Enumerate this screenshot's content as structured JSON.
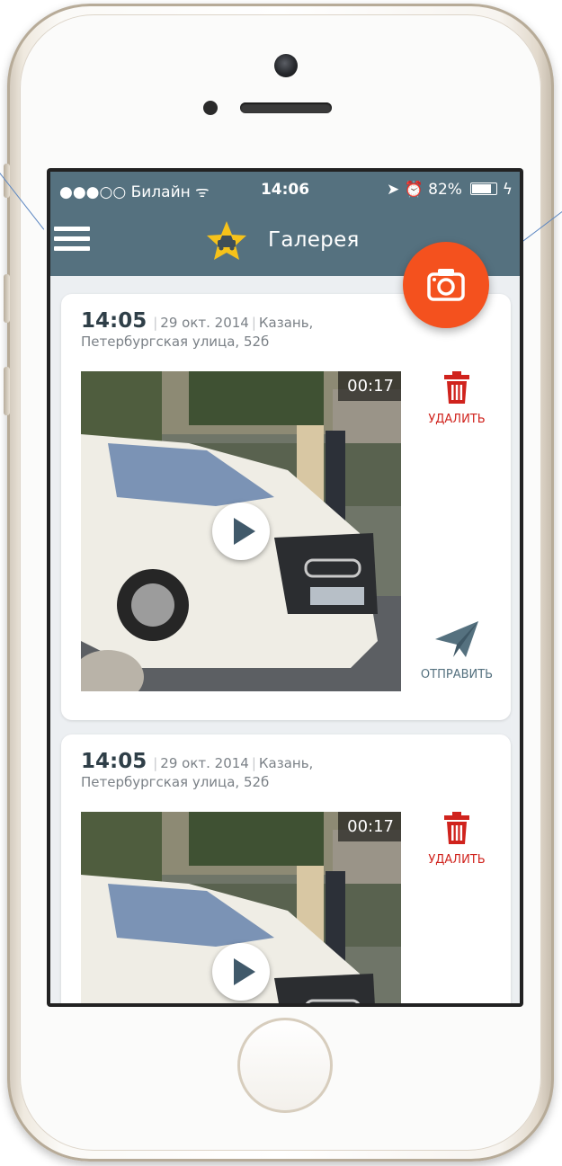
{
  "status_bar": {
    "signal_and_carrier": "●●●○○ Билайн ᯤ",
    "time": "14:06",
    "indicators": "➤ ⏰ 82%",
    "charging_glyph": "ϟ"
  },
  "nav": {
    "title": "Галерея",
    "menu_icon": "hamburger-icon",
    "logo_icon": "star-car-icon",
    "camera_icon": "camera-icon",
    "accent_color": "#f4511e",
    "bar_color": "#55717f"
  },
  "cards": [
    {
      "time": "14:05",
      "date": "29 окт. 2014",
      "city": "Казань,",
      "address": "Петербургская улица, 52б",
      "duration": "00:17",
      "delete_label": "УДАЛИТЬ",
      "send_label": "ОТПРАВИТЬ"
    },
    {
      "time": "14:05",
      "date": "29 окт. 2014",
      "city": "Казань,",
      "address": "Петербургская улица, 52б",
      "duration": "00:17",
      "delete_label": "УДАЛИТЬ"
    }
  ],
  "colors": {
    "delete": "#d0231d",
    "send": "#55717f"
  }
}
